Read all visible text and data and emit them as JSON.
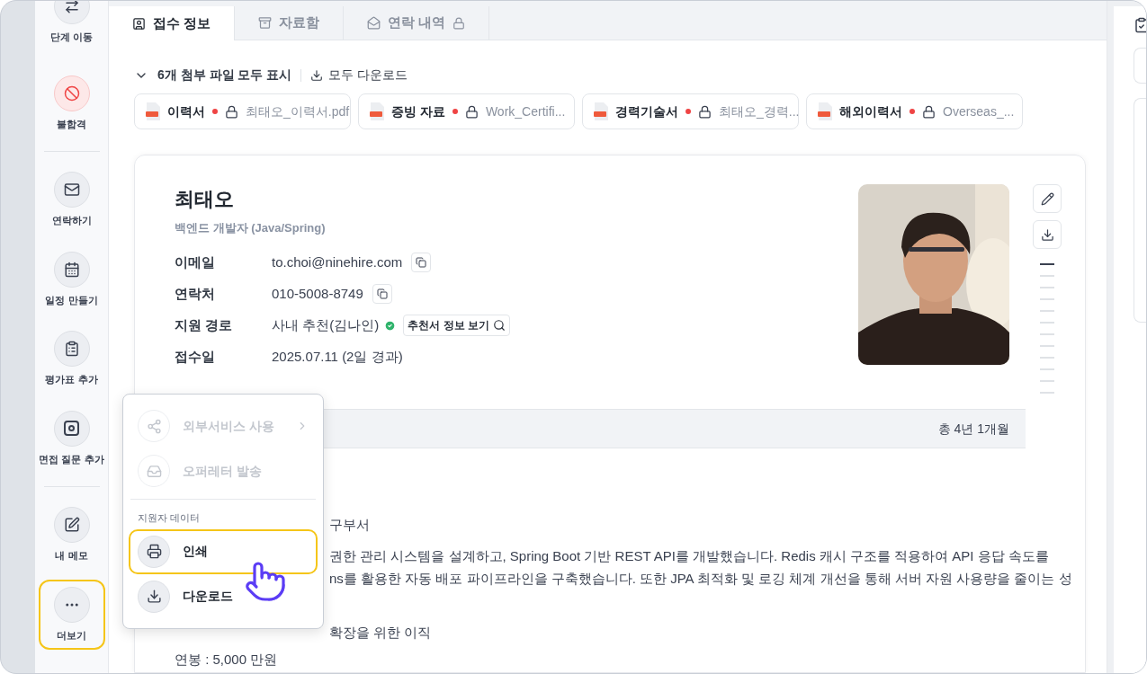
{
  "sidebar": {
    "items": [
      {
        "label": "단계 이동",
        "kind": "normal",
        "selected": false
      },
      {
        "label": "불합격",
        "kind": "danger",
        "selected": false
      },
      {
        "label": "연락하기",
        "kind": "normal",
        "selected": false
      },
      {
        "label": "일정 만들기",
        "kind": "normal",
        "selected": false
      },
      {
        "label": "평가표 추가",
        "kind": "normal",
        "selected": false
      },
      {
        "label": "면접 질문 추가",
        "kind": "normal",
        "selected": false
      },
      {
        "label": "내 메모",
        "kind": "normal",
        "selected": false
      },
      {
        "label": "더보기",
        "kind": "more",
        "selected": true
      }
    ]
  },
  "tabs": [
    {
      "label": "접수 정보",
      "selected": true,
      "locked": false
    },
    {
      "label": "자료함",
      "selected": false,
      "locked": false
    },
    {
      "label": "연락 내역",
      "selected": false,
      "locked": true
    }
  ],
  "attachments": {
    "toggle": "6개 첨부 파일 모두 표시",
    "download_all": "모두 다운로드",
    "files": [
      {
        "type": "이력서",
        "required": true,
        "locked": true,
        "name": "최태오_이력서.pdf"
      },
      {
        "type": "증빙 자료",
        "required": true,
        "locked": true,
        "name": "Work_Certifi..."
      },
      {
        "type": "경력기술서",
        "required": true,
        "locked": true,
        "name": "최태오_경력..."
      },
      {
        "type": "해외이력서",
        "required": true,
        "locked": true,
        "name": "Overseas_..."
      }
    ]
  },
  "profile": {
    "name": "최태오",
    "title": "백엔드 개발자 (Java/Spring)",
    "fields": [
      {
        "label": "이메일",
        "value": "to.choi@ninehire.com",
        "kind": "copy"
      },
      {
        "label": "연락처",
        "value": "010-5008-8749",
        "kind": "copy"
      },
      {
        "label": "지원 경로",
        "value": "사내 추천(김나인)",
        "kind": "verified",
        "action": "추천서 정보 보기"
      },
      {
        "label": "접수일",
        "value": "2025.07.11 (2일 경과)",
        "kind": "plain"
      }
    ]
  },
  "experience": {
    "total": "총 4년 1개월",
    "lines": [
      {
        "text": "구부서",
        "kind": "covered"
      },
      {
        "text": "권한 관리 시스템을 설계하고, Spring Boot 기반 REST API를 개발했습니다. Redis 캐시 구조를 적용하여 API 응답 속도를",
        "kind": "covered"
      },
      {
        "text": "ns를 활용한 자동 배포 파이프라인을 구축했습니다. 또한 JPA 최적화 및 로깅 체계 개선을 통해 서버 자원 사용량을 줄이는 성",
        "kind": "covered"
      },
      {
        "text": "확장을 위한 이직",
        "kind": "covered"
      },
      {
        "text": "연봉 : 5,000 만원",
        "kind": "full"
      }
    ]
  },
  "menu": {
    "groups": [
      {
        "items": [
          {
            "label": "외부서비스 사용",
            "disabled": true,
            "submenu": true,
            "selected": false
          },
          {
            "label": "오퍼레터 발송",
            "disabled": true,
            "submenu": false,
            "selected": false
          }
        ]
      },
      {
        "section": "지원자 데이터",
        "items": [
          {
            "label": "인쇄",
            "disabled": false,
            "submenu": false,
            "selected": true
          },
          {
            "label": "다운로드",
            "disabled": false,
            "submenu": false,
            "selected": false
          }
        ]
      }
    ]
  }
}
